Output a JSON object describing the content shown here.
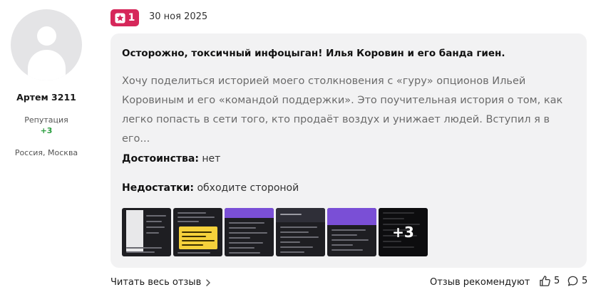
{
  "user": {
    "name": "Артем 3211",
    "reputation_label": "Репутация",
    "reputation_value": "+3",
    "location": "Россия, Москва"
  },
  "review": {
    "rating": "1",
    "date": "30 ноя 2025",
    "title": "Осторожно, токсичный инфоцыган! Илья Коровин и его банда гиен.",
    "text": "Хочу поделиться историей моего столкновения с «гуру» опционов Ильей Коровиным и его «командой поддержки». Это поучительная история о том, как легко попасть в сети того, кто продаёт воздух и унижает людей. Вступил я в его...",
    "pros_label": "Достоинства:",
    "pros_value": "нет",
    "cons_label": "Недостатки:",
    "cons_value": "обходите стороной",
    "more_photos": "+3"
  },
  "footer": {
    "read_more": "Читать весь отзыв",
    "recommend_label": "Отзыв рекомендуют",
    "likes": "5",
    "comments": "5"
  },
  "colors": {
    "badge": "#d6275a",
    "reputation": "#2a9d3f",
    "card_bg": "#f2f2f3"
  },
  "icons": [
    "star-icon",
    "chevron-right-icon",
    "thumbs-up-icon",
    "comment-icon"
  ]
}
